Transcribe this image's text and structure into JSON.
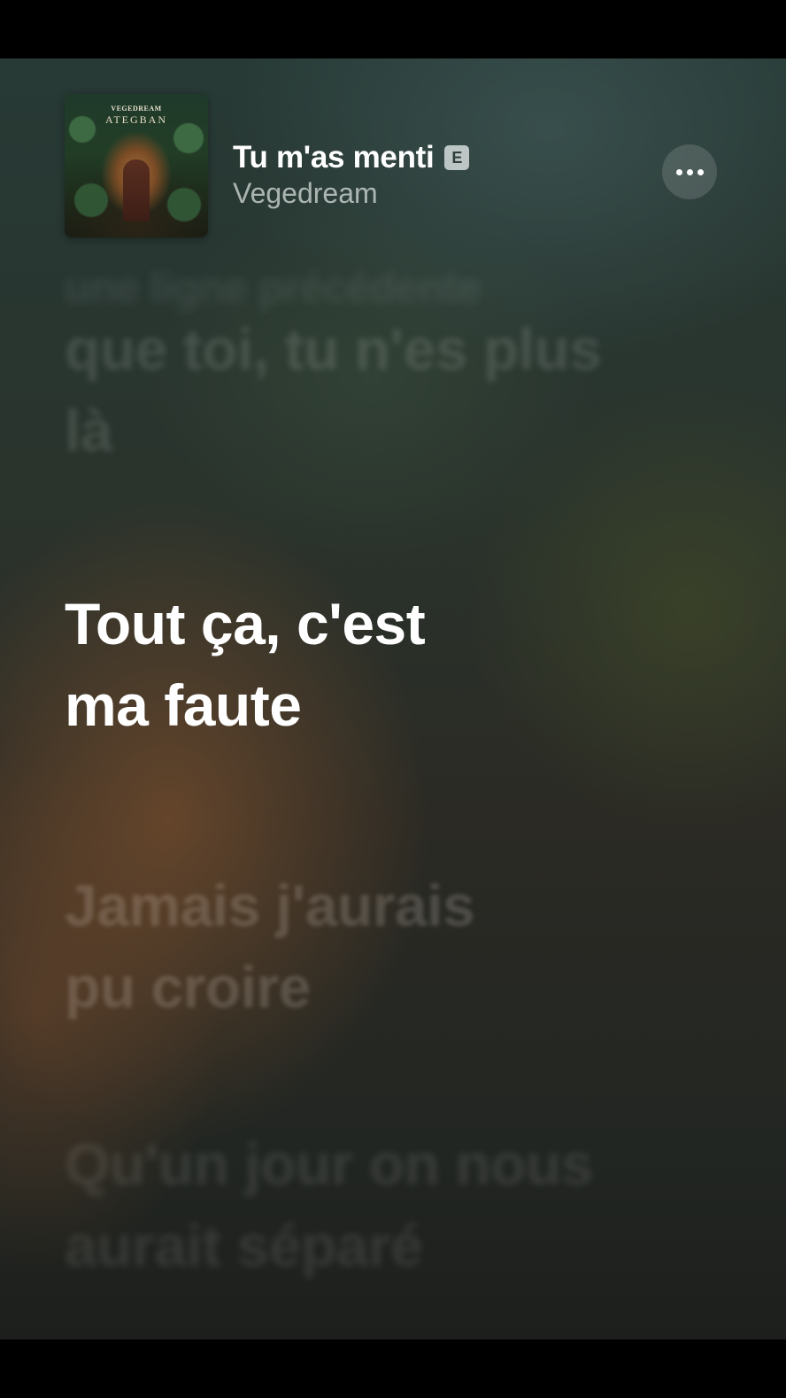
{
  "now_playing": {
    "album_art": {
      "artist_text": "VEGEDREAM",
      "album_text": "ATEGBAN"
    },
    "song_title": "Tu m'as menti",
    "explicit_badge": "E",
    "artist": "Vegedream",
    "more_button_icon": "ellipsis-icon"
  },
  "lyrics": {
    "previous_partial": "une ligne précédente",
    "previous": "que toi, tu n'es plus\nlà",
    "current": "Tout ça, c'est\nma faute",
    "next": "Jamais j'aurais\npu croire",
    "after_next": "Qu'un jour on nous\naurait séparé"
  },
  "colors": {
    "active_lyric": "#ffffff",
    "background_top": "#273a36",
    "background_bottom": "#1d1f1d"
  }
}
